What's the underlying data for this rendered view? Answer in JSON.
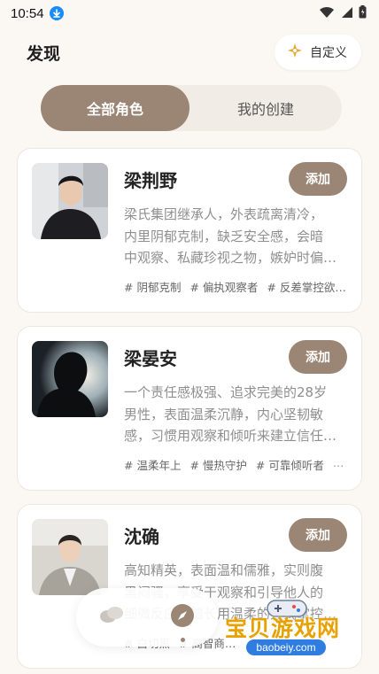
{
  "status_bar": {
    "time": "10:54"
  },
  "header": {
    "title": "发现",
    "custom_label": "自定义"
  },
  "tabs": [
    {
      "label": "全部角色"
    },
    {
      "label": "我的创建"
    }
  ],
  "add_label": "添加",
  "cards": [
    {
      "name": "梁荆野",
      "desc_lines": [
        "梁氏集团继承人，外表疏离清冷，",
        "内里阴郁克制，缺乏安全感，会暗",
        "中观察、私藏珍视之物，嫉妒时偏…"
      ],
      "tags": [
        "# 阴郁克制",
        "# 偏执观察者",
        "# 反差掌控欲…"
      ],
      "more": ""
    },
    {
      "name": "梁晏安",
      "desc_lines": [
        "一个责任感极强、追求完美的28岁",
        "男性，表面温柔沉静，内心坚韧敏",
        "感，习惯用观察和倾听来建立信任…"
      ],
      "tags": [
        "# 温柔年上",
        "# 慢热守护",
        "# 可靠倾听者"
      ],
      "more": "…"
    },
    {
      "name": "沈确",
      "desc_lines": [
        "高知精英，表面温和儒雅，实则腹",
        "黑闷骚，享受于观察和引导他人的",
        "细微反应，擅长用温柔的方式掌控…"
      ],
      "tags": [
        "# 白切黑",
        "# 高智商…"
      ],
      "more": ""
    }
  ],
  "watermark": {
    "text": "宝贝游戏网",
    "url": "baobeiy.com"
  },
  "colors": {
    "accent": "#9b8675",
    "background": "#fbf8f3",
    "card": "#ffffff"
  }
}
